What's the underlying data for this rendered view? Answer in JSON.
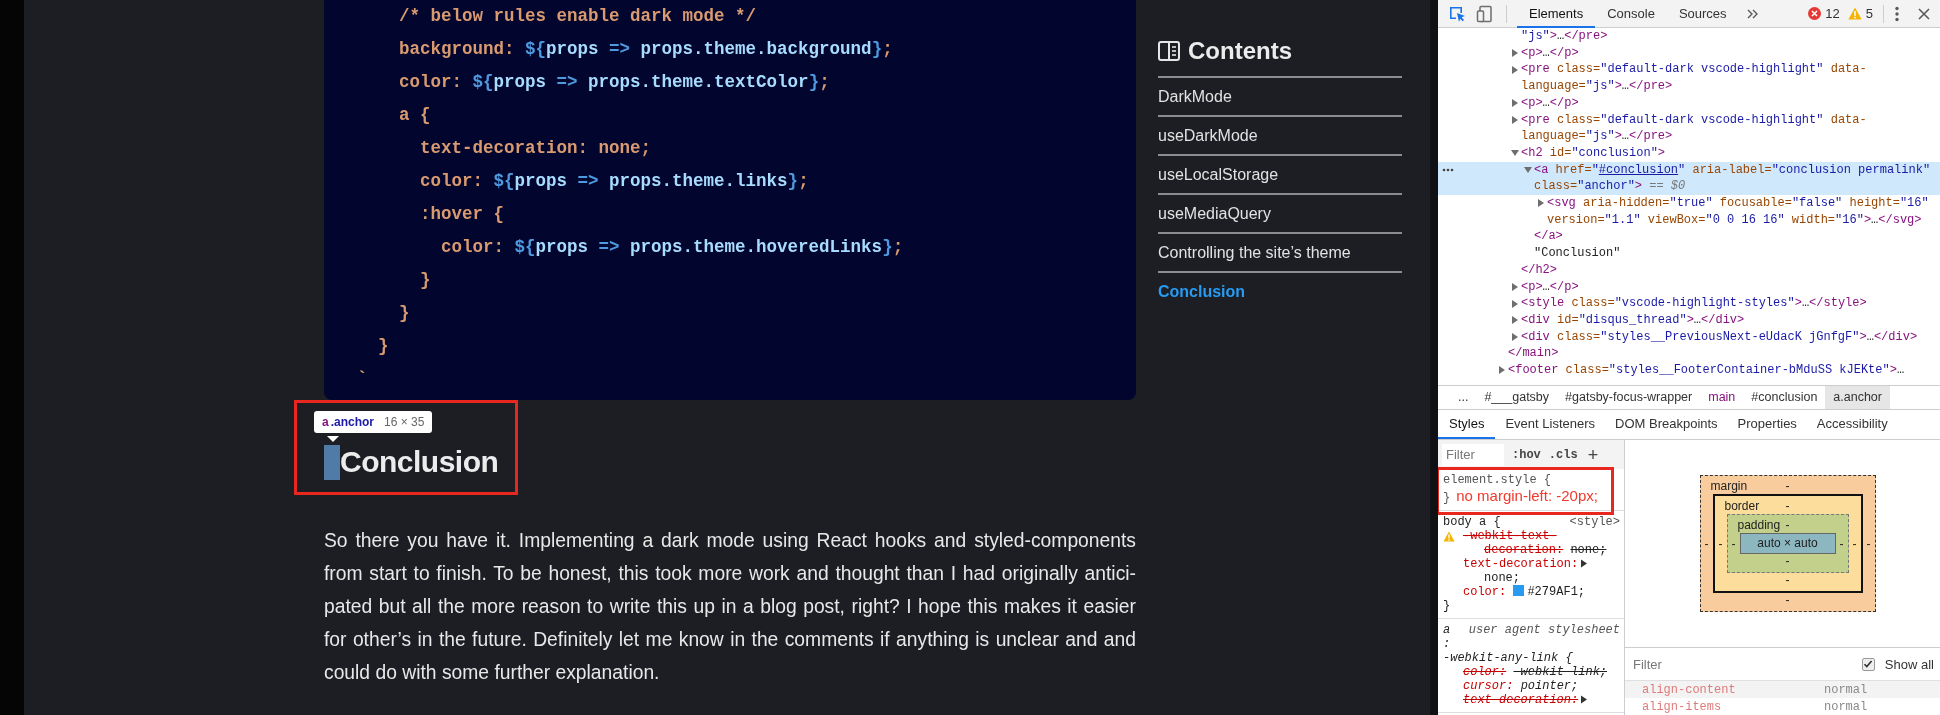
{
  "code_block": {
    "lines": [
      {
        "segments": [
          {
            "kind": "css",
            "text": "    /* below rules enable dark mode */"
          }
        ]
      },
      {
        "segments": [
          {
            "kind": "css",
            "text": "    background: "
          },
          {
            "kind": "interp",
            "text": "${"
          },
          {
            "kind": "js",
            "text": "props"
          },
          {
            "kind": "interp",
            "text": " => "
          },
          {
            "kind": "js",
            "text": "props.theme.background"
          },
          {
            "kind": "interp",
            "text": "}"
          },
          {
            "kind": "css",
            "text": ";"
          }
        ]
      },
      {
        "segments": [
          {
            "kind": "css",
            "text": "    color: "
          },
          {
            "kind": "interp",
            "text": "${"
          },
          {
            "kind": "js",
            "text": "props"
          },
          {
            "kind": "interp",
            "text": " => "
          },
          {
            "kind": "js",
            "text": "props.theme.textColor"
          },
          {
            "kind": "interp",
            "text": "}"
          },
          {
            "kind": "css",
            "text": ";"
          }
        ]
      },
      {
        "segments": [
          {
            "kind": "css",
            "text": "    a {"
          }
        ]
      },
      {
        "segments": [
          {
            "kind": "css",
            "text": "      text-decoration: none;"
          }
        ]
      },
      {
        "segments": [
          {
            "kind": "css",
            "text": "      color: "
          },
          {
            "kind": "interp",
            "text": "${"
          },
          {
            "kind": "js",
            "text": "props"
          },
          {
            "kind": "interp",
            "text": " => "
          },
          {
            "kind": "js",
            "text": "props.theme.links"
          },
          {
            "kind": "interp",
            "text": "}"
          },
          {
            "kind": "css",
            "text": ";"
          }
        ]
      },
      {
        "segments": [
          {
            "kind": "css",
            "text": "      :hover {"
          }
        ]
      },
      {
        "segments": [
          {
            "kind": "css",
            "text": "        color: "
          },
          {
            "kind": "interp",
            "text": "${"
          },
          {
            "kind": "js",
            "text": "props"
          },
          {
            "kind": "interp",
            "text": " => "
          },
          {
            "kind": "js",
            "text": "props.theme.hoveredLinks"
          },
          {
            "kind": "interp",
            "text": "}"
          },
          {
            "kind": "css",
            "text": ";"
          }
        ]
      },
      {
        "segments": [
          {
            "kind": "css",
            "text": "      }"
          }
        ]
      },
      {
        "segments": [
          {
            "kind": "css",
            "text": "    }"
          }
        ]
      },
      {
        "segments": [
          {
            "kind": "css",
            "text": "  }"
          }
        ]
      },
      {
        "segments": [
          {
            "kind": "css",
            "text": "`"
          }
        ]
      }
    ]
  },
  "article": {
    "tooltip": {
      "tag": "a",
      "class_name": ".anchor",
      "size": "16 × 35"
    },
    "heading": "Conclusion",
    "frame_marked": true,
    "paragraph": "So there you have it. Implementing a dark mode using React hooks and styled-components from start to finish. To be honest, this took more work and thought than I had originally antici-pated but all the more reason to write this up in a blog post, right? I hope this makes it easier for other’s in the future. Definitely let me know in the comments if anything is unclear and and could do with some further explanation."
  },
  "contents": {
    "title": "Contents",
    "items": [
      {
        "label": "DarkMode",
        "selected": false
      },
      {
        "label": "useDarkMode",
        "selected": false
      },
      {
        "label": "useLocalStorage",
        "selected": false
      },
      {
        "label": "useMediaQuery",
        "selected": false
      },
      {
        "label": "Controlling the site’s theme",
        "selected": false
      },
      {
        "label": "Conclusion",
        "selected": true
      }
    ]
  },
  "devtools": {
    "inspect_mode": true,
    "tabs": [
      {
        "label": "Elements",
        "selected": true
      },
      {
        "label": "Console",
        "selected": false
      },
      {
        "label": "Sources",
        "selected": false
      }
    ],
    "errors": "12",
    "warnings": "5",
    "dom_tree": [
      {
        "children": [
          {
            "selected": false,
            "tokens": [
              {
                "kind": "value",
                "text": "\"js\""
              },
              {
                "kind": "tag",
                "text": ">"
              },
              {
                "kind": "text",
                "text": "…"
              },
              {
                "kind": "tag",
                "text": "</pre>"
              }
            ]
          },
          {
            "selected": false,
            "expanded": false,
            "tokens": [
              {
                "kind": "tag",
                "text": "<p>"
              },
              {
                "kind": "text",
                "text": "…"
              },
              {
                "kind": "tag",
                "text": "</p>"
              }
            ]
          },
          {
            "selected": false,
            "expanded": false,
            "tokens": [
              {
                "kind": "tag",
                "text": "<pre"
              },
              {
                "kind": "attr",
                "text": " class="
              },
              {
                "kind": "value",
                "text": "\"default-dark vscode-highlight\""
              },
              {
                "kind": "attr",
                "text": " data-language="
              },
              {
                "kind": "value",
                "text": "\"js\""
              },
              {
                "kind": "tag",
                "text": ">"
              },
              {
                "kind": "text",
                "text": "…"
              },
              {
                "kind": "tag",
                "text": "</pre>"
              }
            ]
          },
          {
            "selected": false,
            "expanded": false,
            "tokens": [
              {
                "kind": "tag",
                "text": "<p>"
              },
              {
                "kind": "text",
                "text": "…"
              },
              {
                "kind": "tag",
                "text": "</p>"
              }
            ]
          },
          {
            "selected": false,
            "expanded": false,
            "tokens": [
              {
                "kind": "tag",
                "text": "<pre"
              },
              {
                "kind": "attr",
                "text": " class="
              },
              {
                "kind": "value",
                "text": "\"default-dark vscode-highlight\""
              },
              {
                "kind": "attr",
                "text": " data-language="
              },
              {
                "kind": "value",
                "text": "\"js\""
              },
              {
                "kind": "tag",
                "text": ">"
              },
              {
                "kind": "text",
                "text": "…"
              },
              {
                "kind": "tag",
                "text": "</pre>"
              }
            ]
          },
          {
            "selected": false,
            "expanded": true,
            "tokens": [
              {
                "kind": "tag",
                "text": "<h2"
              },
              {
                "kind": "attr",
                "text": " id="
              },
              {
                "kind": "value",
                "text": "\"conclusion\""
              },
              {
                "kind": "tag",
                "text": ">"
              }
            ],
            "children": [
              {
                "selected": true,
                "expanded": true,
                "tokens": [
                  {
                    "kind": "tag",
                    "text": "<a"
                  },
                  {
                    "kind": "attr",
                    "text": " href="
                  },
                  {
                    "kind": "value",
                    "text": "\""
                  },
                  {
                    "kind": "link",
                    "text": "#conclusion"
                  },
                  {
                    "kind": "value",
                    "text": "\""
                  },
                  {
                    "kind": "attr",
                    "text": " aria-label="
                  },
                  {
                    "kind": "value",
                    "text": "\"conclusion permalink\""
                  },
                  {
                    "kind": "attr",
                    "text": " class="
                  },
                  {
                    "kind": "value",
                    "text": "\"anchor\""
                  },
                  {
                    "kind": "tag",
                    "text": ">"
                  },
                  {
                    "kind": "note",
                    "text": " == $0"
                  }
                ],
                "children": [
                  {
                    "selected": false,
                    "expanded": false,
                    "tokens": [
                      {
                        "kind": "tag",
                        "text": "<svg"
                      },
                      {
                        "kind": "attr",
                        "text": " aria-hidden="
                      },
                      {
                        "kind": "value",
                        "text": "\"true\""
                      },
                      {
                        "kind": "attr",
                        "text": " focusable="
                      },
                      {
                        "kind": "value",
                        "text": "\"false\""
                      },
                      {
                        "kind": "attr",
                        "text": " height="
                      },
                      {
                        "kind": "value",
                        "text": "\"16\""
                      },
                      {
                        "kind": "attr",
                        "text": " version="
                      },
                      {
                        "kind": "value",
                        "text": "\"1.1\""
                      },
                      {
                        "kind": "attr",
                        "text": " viewBox="
                      },
                      {
                        "kind": "value",
                        "text": "\"0 0 16 16\""
                      },
                      {
                        "kind": "attr",
                        "text": " width="
                      },
                      {
                        "kind": "value",
                        "text": "\"16\""
                      },
                      {
                        "kind": "tag",
                        "text": ">"
                      },
                      {
                        "kind": "text",
                        "text": "…"
                      },
                      {
                        "kind": "tag",
                        "text": "</svg>"
                      }
                    ]
                  }
                ],
                "closing": [
                  {
                    "kind": "tag",
                    "text": "</a>"
                  }
                ]
              },
              {
                "selected": false,
                "tokens": [
                  {
                    "kind": "text",
                    "text": "\"Conclusion\""
                  }
                ]
              }
            ],
            "closing": [
              {
                "kind": "tag",
                "text": "</h2>"
              }
            ]
          },
          {
            "selected": false,
            "expanded": false,
            "tokens": [
              {
                "kind": "tag",
                "text": "<p>"
              },
              {
                "kind": "text",
                "text": "…"
              },
              {
                "kind": "tag",
                "text": "</p>"
              }
            ]
          },
          {
            "selected": false,
            "expanded": false,
            "tokens": [
              {
                "kind": "tag",
                "text": "<style"
              },
              {
                "kind": "attr",
                "text": " class="
              },
              {
                "kind": "value",
                "text": "\"vscode-highlight-styles\""
              },
              {
                "kind": "tag",
                "text": ">"
              },
              {
                "kind": "text",
                "text": "…"
              },
              {
                "kind": "tag",
                "text": "</style>"
              }
            ]
          },
          {
            "selected": false,
            "expanded": false,
            "tokens": [
              {
                "kind": "tag",
                "text": "<div"
              },
              {
                "kind": "attr",
                "text": " id="
              },
              {
                "kind": "value",
                "text": "\"disqus_thread\""
              },
              {
                "kind": "tag",
                "text": ">"
              },
              {
                "kind": "text",
                "text": "…"
              },
              {
                "kind": "tag",
                "text": "</div>"
              }
            ]
          },
          {
            "selected": false,
            "expanded": false,
            "tokens": [
              {
                "kind": "tag",
                "text": "<div"
              },
              {
                "kind": "attr",
                "text": " class="
              },
              {
                "kind": "value",
                "text": "\"styles__PreviousNext-eUdacK jGnfgF\""
              },
              {
                "kind": "tag",
                "text": ">"
              },
              {
                "kind": "text",
                "text": "…"
              },
              {
                "kind": "tag",
                "text": "</div>"
              }
            ]
          }
        ],
        "closing": [
          {
            "kind": "tag",
            "text": "</main>"
          }
        ]
      },
      {
        "selected": false,
        "expanded": false,
        "tokens": [
          {
            "kind": "tag",
            "text": "<footer"
          },
          {
            "kind": "attr",
            "text": " class="
          },
          {
            "kind": "value",
            "text": "\"styles__FooterContainer-bMduSS kJEKte\""
          },
          {
            "kind": "tag",
            "text": ">"
          },
          {
            "kind": "text",
            "text": "…"
          }
        ]
      }
    ],
    "breadcrumbs": [
      {
        "label": "...",
        "kind": "more",
        "selected": false
      },
      {
        "label": "#___gatsby",
        "kind": "id",
        "selected": false
      },
      {
        "label": "#gatsby-focus-wrapper",
        "kind": "id",
        "selected": false
      },
      {
        "label": "main",
        "kind": "tag",
        "selected": false
      },
      {
        "label": "#conclusion",
        "kind": "id",
        "selected": false
      },
      {
        "label": "a.anchor",
        "kind": "tag",
        "selected": true
      }
    ],
    "panel_tabs": [
      {
        "label": "Styles",
        "selected": true
      },
      {
        "label": "Event Listeners",
        "selected": false
      },
      {
        "label": "DOM Breakpoints",
        "selected": false
      },
      {
        "label": "Properties",
        "selected": false
      },
      {
        "label": "Accessibility",
        "selected": false
      }
    ],
    "styles": {
      "filter_placeholder": "Filter",
      "hov": ":hov",
      "cls": ".cls",
      "add": "+",
      "rules": [
        {
          "kind": "inline",
          "selector_lines": [
            "element.style {"
          ],
          "closing": "}",
          "annotation": "no margin-left: -20px;",
          "marked": true
        },
        {
          "kind": "author",
          "selector_lines": [
            "body a {"
          ],
          "source": "<style>",
          "closing": "}",
          "declarations": [
            {
              "property": "-webkit-text-decoration:",
              "value": "none;",
              "struck": true,
              "warning": true
            },
            {
              "property": "text-decoration:",
              "value": "none;",
              "struck": false,
              "expandable": true
            },
            {
              "property": "color:",
              "value": "#279AF1;",
              "struck": false,
              "color": "#279af1"
            }
          ]
        },
        {
          "kind": "user",
          "selector_lines": [
            "a",
            ":",
            "-webkit-any-link {"
          ],
          "source": "user agent stylesheet",
          "declarations": [
            {
              "property": "color:",
              "value": "-webkit-link;",
              "struck": true
            },
            {
              "property": "cursor:",
              "value": "pointer;",
              "struck": false
            },
            {
              "property": "text-decoration:",
              "struck": true,
              "expandable": true
            }
          ]
        }
      ]
    },
    "box_model": {
      "layers": [
        {
          "kind": "margin",
          "label": "margin",
          "top": "-",
          "left": "-"
        },
        {
          "kind": "border",
          "label": "border",
          "top": "-",
          "left": "-"
        },
        {
          "kind": "padding",
          "label": "padding",
          "top": "-",
          "left": "-"
        }
      ],
      "content": "auto × auto",
      "right_values": [
        "-",
        "-",
        "-"
      ],
      "bottom_values": [
        "-",
        "-",
        "-"
      ]
    },
    "computed": {
      "filter_placeholder": "Filter",
      "show_all": {
        "label": "Show all",
        "checked": true
      },
      "properties": [
        {
          "name": "align-content",
          "value": "normal"
        },
        {
          "name": "align-items",
          "value": "normal"
        }
      ]
    }
  }
}
